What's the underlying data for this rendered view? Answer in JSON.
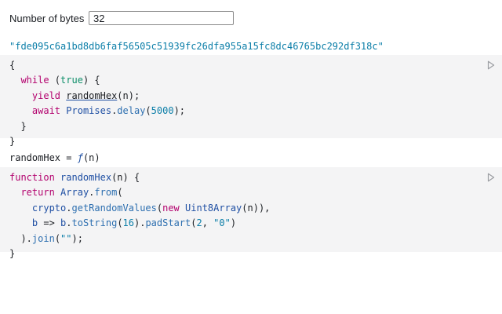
{
  "input": {
    "label": "Number of bytes",
    "value": "32"
  },
  "output": {
    "hex": "\"fde095c6a1bd8db6faf56505c51939fc26dfa955a15fc8dc46765bc292df318c\""
  },
  "cell1": {
    "line1": "{",
    "while_kw": "while",
    "paren_open": " (",
    "true_kw": "true",
    "paren_close_brace": ") {",
    "yield_kw": "yield",
    "randomHex_ref": "randomHex",
    "yield_args": "(n);",
    "await_kw": "await",
    "promises": "Promises",
    "dot": ".",
    "delay": "delay",
    "delay_open": "(",
    "delay_value": "5000",
    "delay_close": ");",
    "inner_close": "}",
    "outer_close": "}"
  },
  "variable": {
    "name": "randomHex",
    "equals": " = ",
    "f": "ƒ",
    "args": "(n)"
  },
  "cell2": {
    "function_kw": "function",
    "fn_name": "randomHex",
    "fn_sig": "(n) {",
    "return_kw": "return",
    "array": "Array",
    "from": "from",
    "from_open": "(",
    "crypto": "crypto",
    "getRandomValues": "getRandomValues",
    "grv_open": "(",
    "new_kw": "new",
    "uint8": "Uint8Array",
    "uint8_args": "(n)),",
    "b_param": "b",
    "arrow": " => ",
    "b_ref": "b",
    "toString": "toString",
    "ts_open": "(",
    "ts_arg": "16",
    "ts_close": ").",
    "padStart": "padStart",
    "ps_open": "(",
    "ps_arg1": "2",
    "ps_sep": ", ",
    "ps_arg2": "\"0\"",
    "ps_close": ")",
    "join_prefix": ").",
    "join": "join",
    "join_open": "(",
    "join_arg": "\"\"",
    "join_close": ");",
    "fn_close": "}"
  },
  "icons": {
    "run": "play-icon"
  },
  "colors": {
    "keyword": "#b3026e",
    "boolean": "#0f8f6a",
    "string": "#0b7ea8",
    "cell_background": "#f4f4f5"
  }
}
